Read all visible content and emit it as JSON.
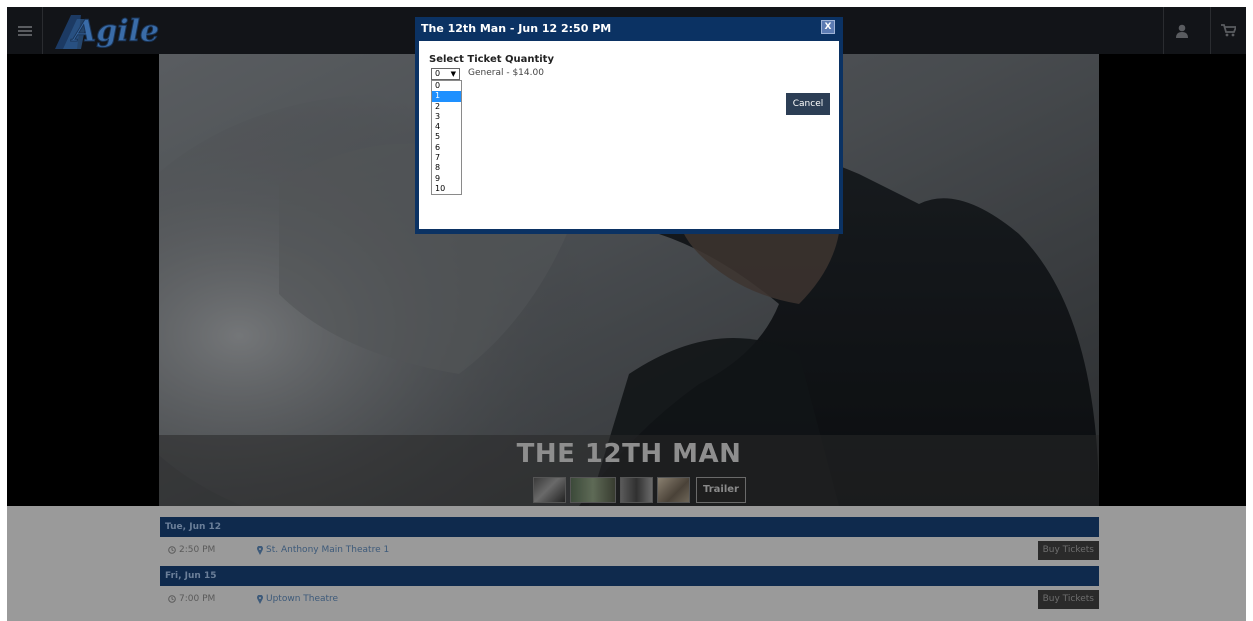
{
  "header": {
    "logo_text": "Agile",
    "menu_icon": "hamburger-icon",
    "user_icon": "user-icon",
    "cart_icon": "cart-icon"
  },
  "movie": {
    "title": "THE 12TH MAN",
    "trailer_label": "Trailer"
  },
  "modal": {
    "title": "The 12th Man - Jun 12 2:50 PM",
    "close_label": "X",
    "heading": "Select Ticket Quantity",
    "quantity_value": "0",
    "ticket_type": "General - $14.00",
    "options": [
      "0",
      "1",
      "2",
      "3",
      "4",
      "5",
      "6",
      "7",
      "8",
      "9",
      "10"
    ],
    "highlighted_option": "1",
    "cancel_label": "Cancel"
  },
  "showtimes": [
    {
      "day": "Tue, Jun 12",
      "time": "2:50 PM",
      "venue": "St. Anthony Main Theatre 1",
      "buy_label": "Buy Tickets"
    },
    {
      "day": "Fri, Jun 15",
      "time": "7:00 PM",
      "venue": "Uptown Theatre",
      "buy_label": "Buy Tickets"
    }
  ],
  "colors": {
    "brand_navy": "#0b3263",
    "cancel_button": "#2c3e55",
    "highlight": "#1e90ff",
    "overlay_gray": "#9a9a9a"
  }
}
